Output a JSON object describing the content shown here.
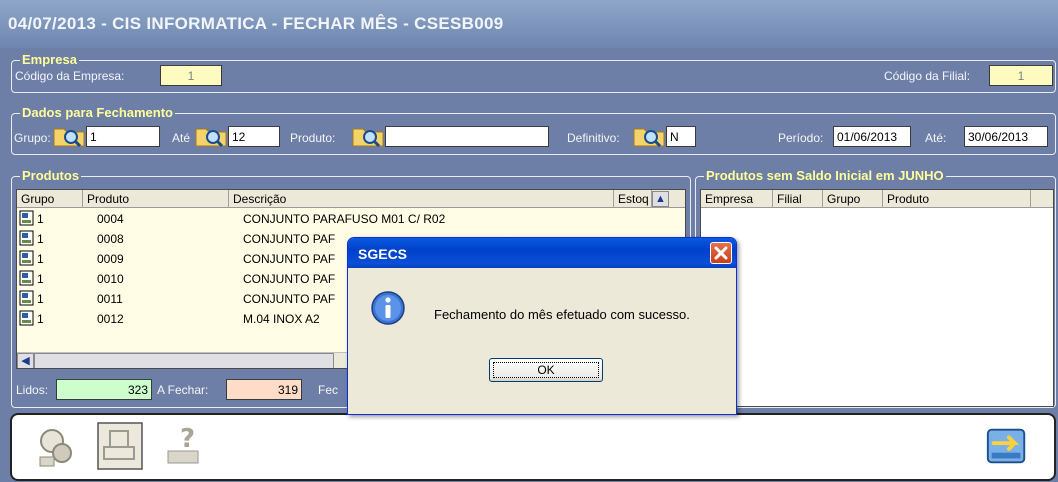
{
  "window": {
    "title": "04/07/2013  -  CIS INFORMATICA  -  FECHAR MÊS  -  CSESB009"
  },
  "empresa": {
    "legend": "Empresa",
    "codigo_empresa_label": "Código da Empresa:",
    "codigo_empresa_value": "1",
    "codigo_filial_label": "Código da Filial:",
    "codigo_filial_value": "1"
  },
  "fechamento": {
    "legend": "Dados para Fechamento",
    "grupo_label": "Grupo:",
    "grupo_value": "1",
    "ate_label": "Até",
    "ate_value": "12",
    "produto_label": "Produto:",
    "produto_value": "",
    "definitivo_label": "Definitivo:",
    "definitivo_value": "N",
    "periodo_label": "Período:",
    "periodo_value": "01/06/2013",
    "periodo_ate_label": "Até:",
    "periodo_ate_value": "30/06/2013"
  },
  "produtos": {
    "legend": "Produtos",
    "columns": [
      "Grupo",
      "Produto",
      "Descrição",
      "Estoq"
    ],
    "rows": [
      {
        "grupo": "1",
        "produto": "0004",
        "descricao": "CONJUNTO PARAFUSO M01 C/ R02"
      },
      {
        "grupo": "1",
        "produto": "0008",
        "descricao": "CONJUNTO PAF"
      },
      {
        "grupo": "1",
        "produto": "0009",
        "descricao": "CONJUNTO PAF"
      },
      {
        "grupo": "1",
        "produto": "0010",
        "descricao": "CONJUNTO PAF"
      },
      {
        "grupo": "1",
        "produto": "0011",
        "descricao": "CONJUNTO PAF"
      },
      {
        "grupo": "1",
        "produto": "0012",
        "descricao": "M.04 INOX A2"
      }
    ],
    "lidos_label": "Lidos:",
    "lidos_value": "323",
    "a_fechar_label": "A Fechar:",
    "a_fechar_value": "319",
    "fec_label": "Fec"
  },
  "sem_saldo": {
    "legend": "Produtos sem Saldo Inicial em JUNHO",
    "columns": [
      "Empresa",
      "Filial",
      "Grupo",
      "Produto"
    ]
  },
  "dialog": {
    "title": "SGECS",
    "message": "Fechamento do mês efetuado com sucesso.",
    "ok_label": "OK"
  },
  "toolbar": {
    "icons": [
      "search-person-icon",
      "print-disabled-icon",
      "help-disabled-icon",
      "exit-icon"
    ]
  },
  "colors": {
    "background": "#6d7fa6",
    "legend": "#ffff99",
    "grid_background": "#fffde6",
    "lidos": "#ccffcc",
    "a_fechar": "#ffdcc8"
  }
}
